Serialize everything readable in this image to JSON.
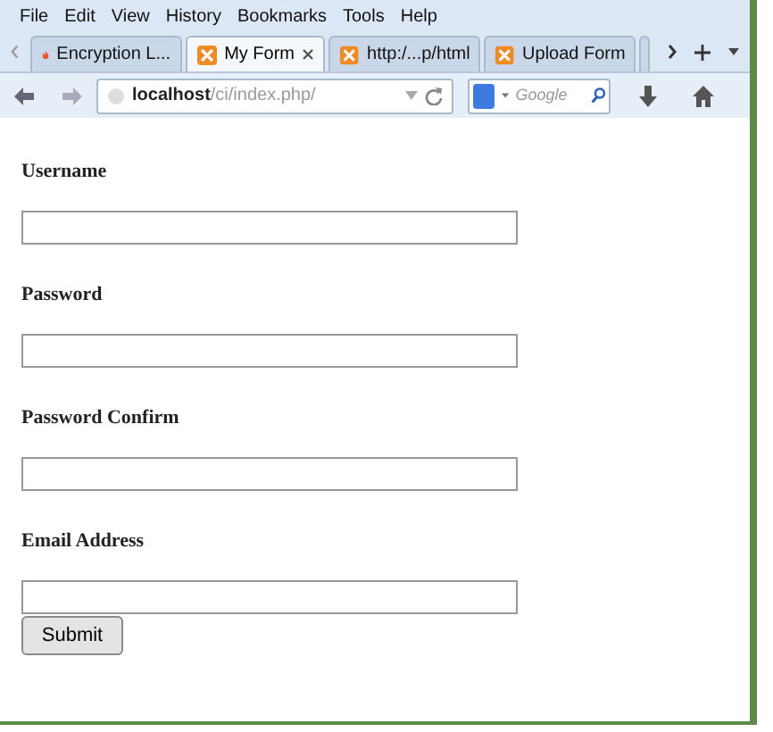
{
  "menu": [
    "File",
    "Edit",
    "View",
    "History",
    "Bookmarks",
    "Tools",
    "Help"
  ],
  "tabs": [
    {
      "label": "Encryption L...",
      "selected": false,
      "kind": "flame"
    },
    {
      "label": "My Form",
      "selected": true,
      "kind": "box"
    },
    {
      "label": "http:/...p/html",
      "selected": false,
      "kind": "box"
    },
    {
      "label": "Upload Form",
      "selected": false,
      "kind": "box"
    }
  ],
  "address": {
    "host": "localhost",
    "path": "/ci/index.php/"
  },
  "search": {
    "placeholder": "Google"
  },
  "form": {
    "fields": [
      {
        "label": "Username"
      },
      {
        "label": "Password"
      },
      {
        "label": "Password Confirm"
      },
      {
        "label": "Email Address"
      }
    ],
    "submit": "Submit"
  }
}
